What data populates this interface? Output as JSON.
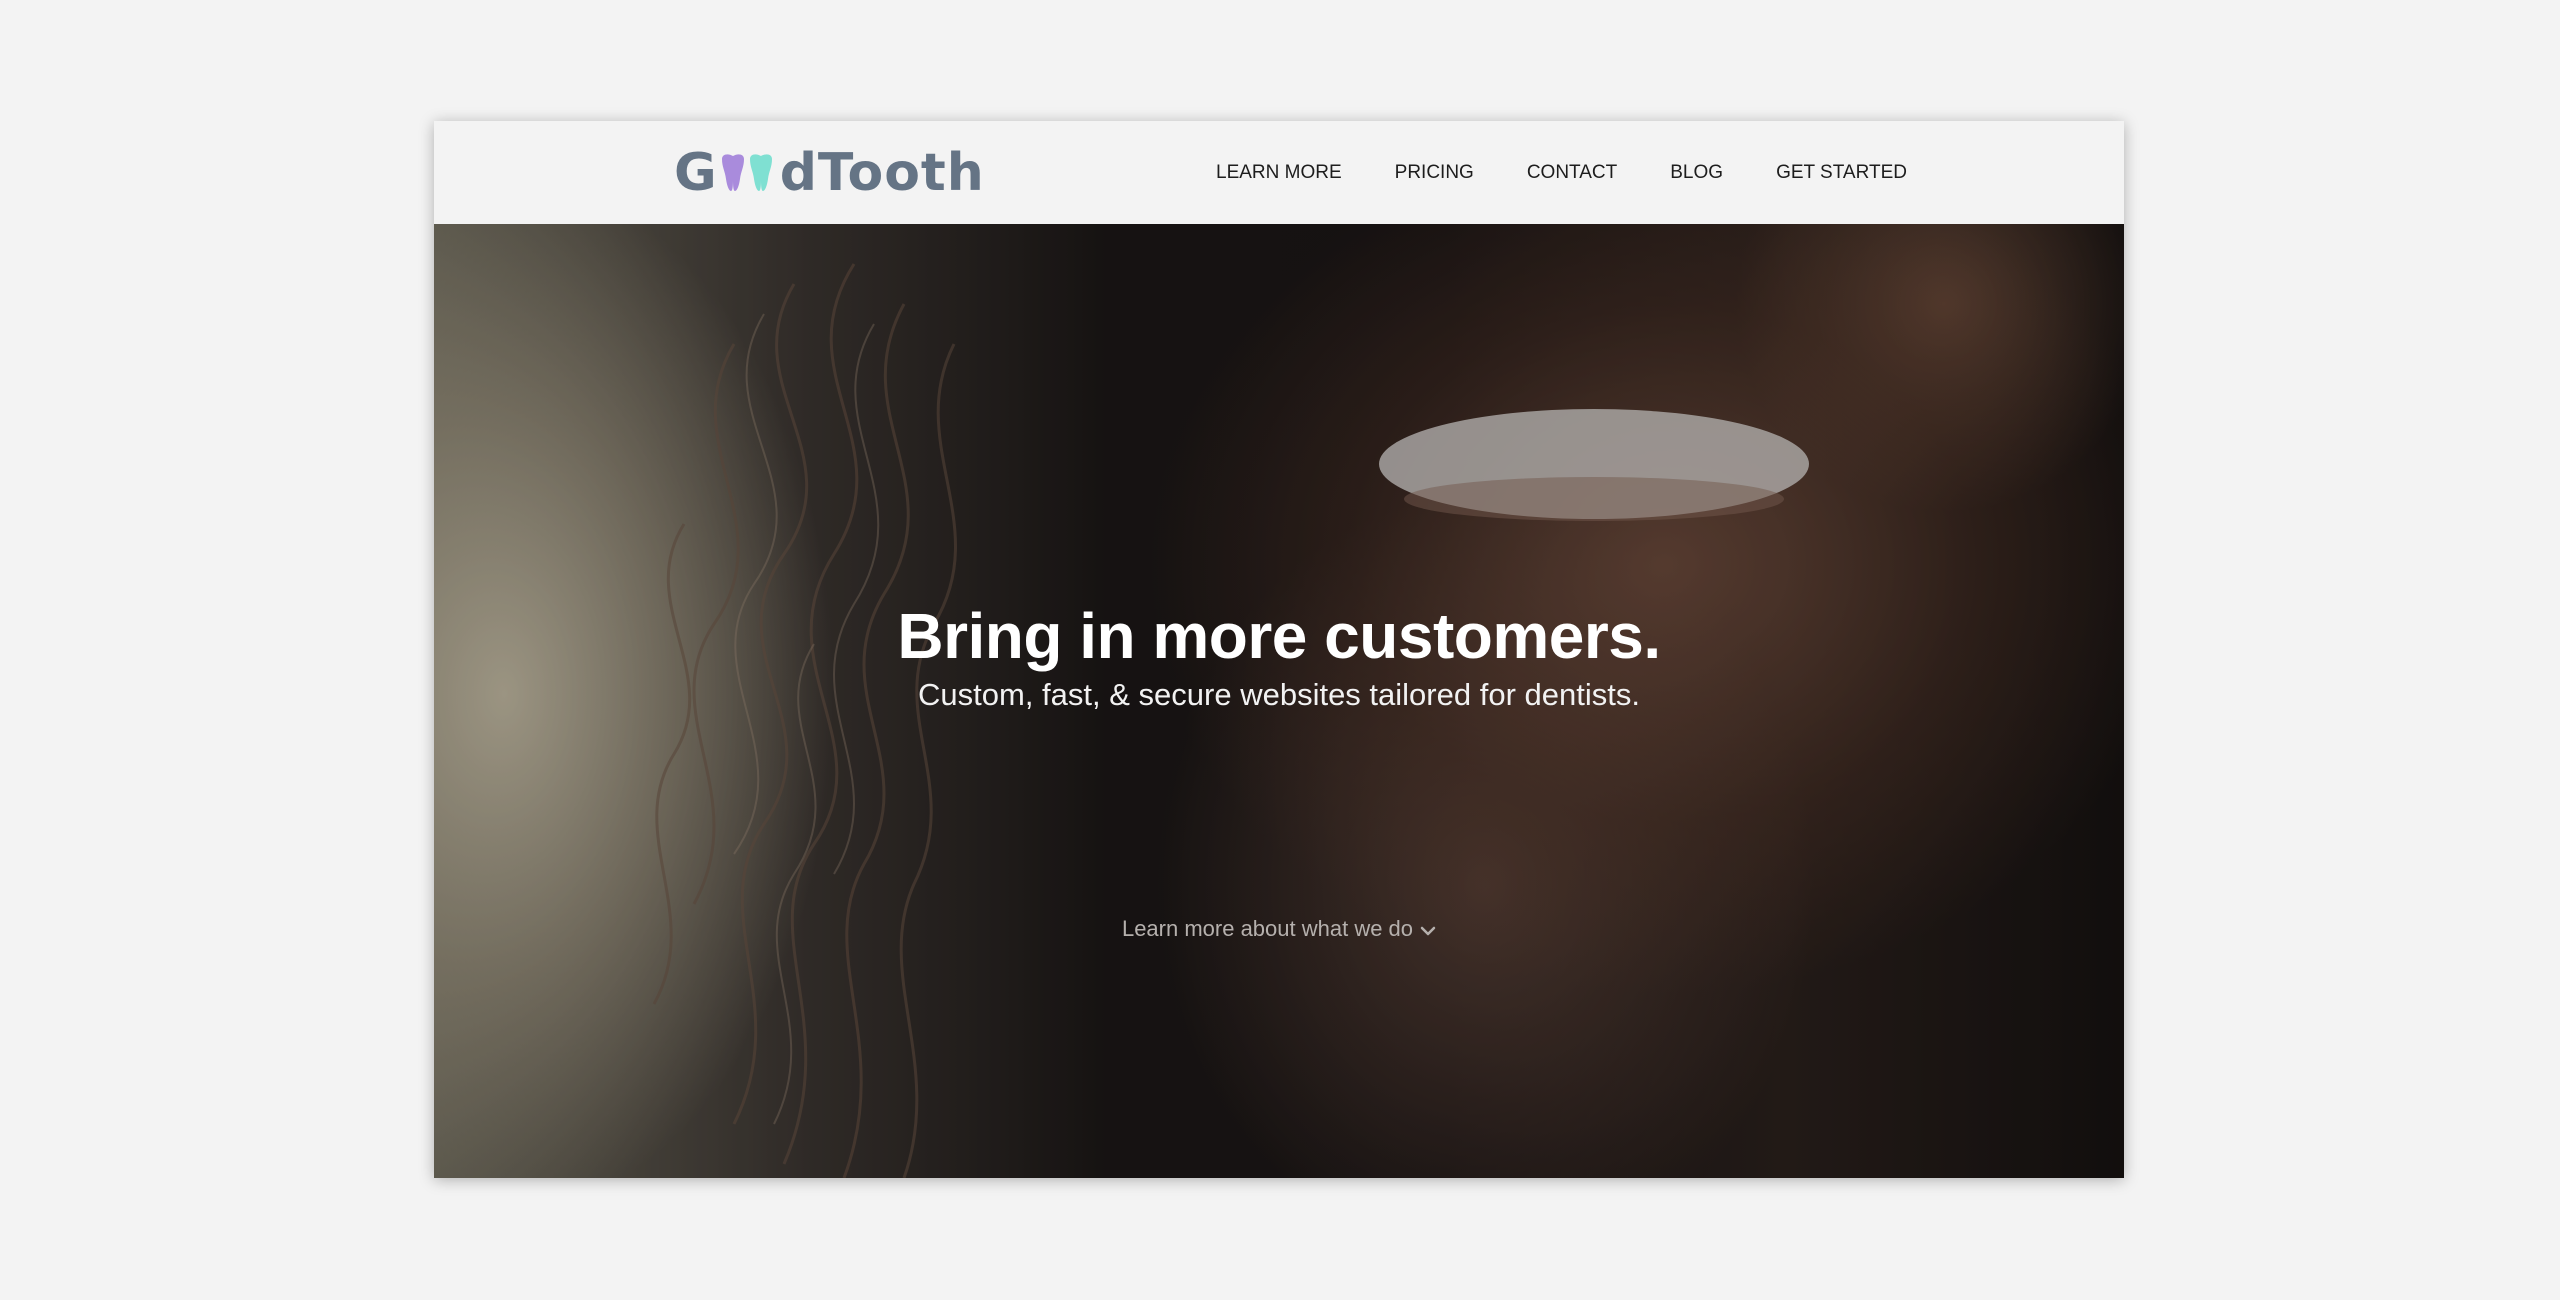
{
  "header": {
    "logo": {
      "prefix": "G",
      "suffix": "dTooth",
      "tooth_colors": [
        "#a98bdc",
        "#7fe0d2"
      ],
      "text_color": "#657485"
    },
    "nav": [
      {
        "label": "LEARN MORE"
      },
      {
        "label": "PRICING"
      },
      {
        "label": "CONTACT"
      },
      {
        "label": "BLOG"
      },
      {
        "label": "GET STARTED"
      }
    ]
  },
  "hero": {
    "title": "Bring in more customers.",
    "subtitle": "Custom, fast, & secure websites tailored for dentists.",
    "cta": {
      "label": "Learn more about what we do",
      "icon": "chevron-down-icon"
    }
  },
  "colors": {
    "page_background": "#f3f3f3",
    "header_background": "#f3f3f3",
    "nav_text": "#1d1d1d",
    "hero_text": "#ffffff",
    "cta_text": "#b5b0ad"
  }
}
